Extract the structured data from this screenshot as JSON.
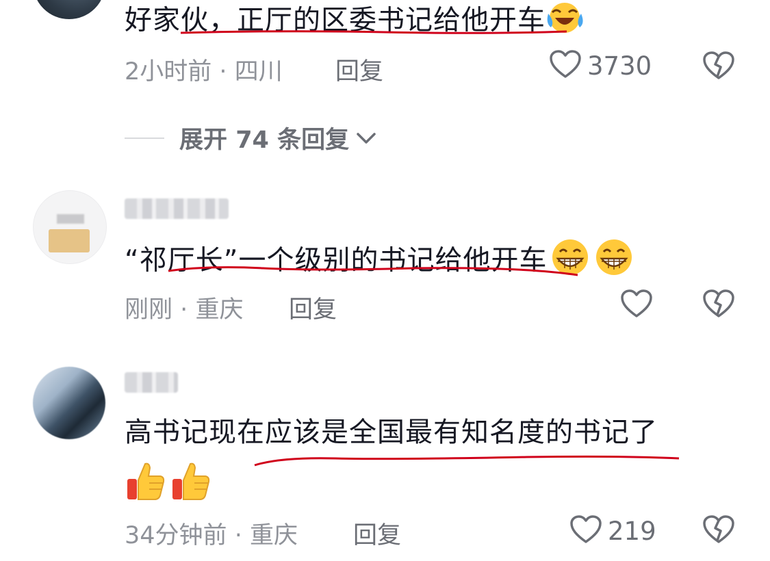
{
  "comments": [
    {
      "text": "好家伙，正厅的区委书记给他开车",
      "emoji": [
        "face-with-tears-of-joy"
      ],
      "time": "2小时前",
      "location": "四川",
      "reply_label": "回复",
      "likes": "3730"
    },
    {
      "text": "“祁厅长”一个级别的书记给他开车",
      "emoji": [
        "grinning-face",
        "grinning-face"
      ],
      "time": "刚刚",
      "location": "重庆",
      "reply_label": "回复",
      "likes": ""
    },
    {
      "text": "高书记现在应该是全国最有知名度的书记了",
      "emoji": [
        "thumbs-up",
        "thumbs-up"
      ],
      "time": "34分钟前",
      "location": "重庆",
      "reply_label": "回复",
      "likes": "219"
    }
  ],
  "expand_replies": {
    "prefix": "展开",
    "count": "74",
    "suffix": "条回复"
  },
  "meta_separator": "·",
  "icons": {
    "like": "heart-outline-icon",
    "dislike": "broken-heart-icon",
    "expand": "chevron-down-icon"
  },
  "colors": {
    "text": "#161823",
    "meta": "#8f9299",
    "action": "#6b6e75",
    "underline": "#d0021b"
  }
}
